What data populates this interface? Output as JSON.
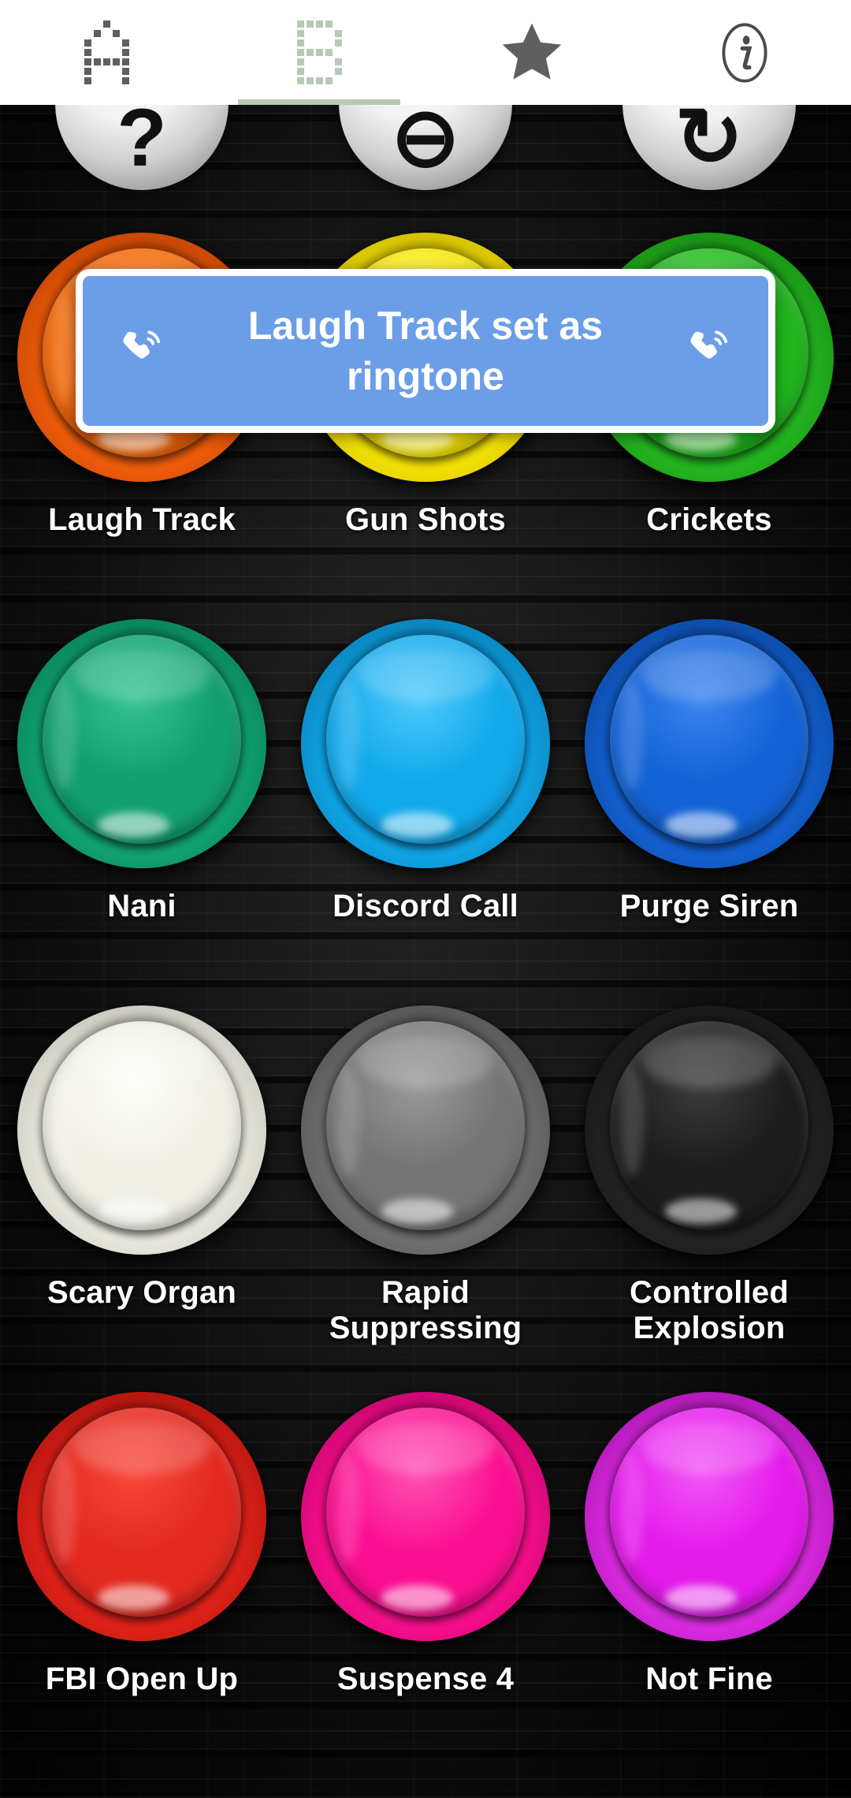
{
  "tabbar": {
    "tabs": [
      {
        "id": "tab-a",
        "icon": "pixel-letter-a-icon",
        "label": "A",
        "active": false,
        "color": "#5f5f5f"
      },
      {
        "id": "tab-b",
        "icon": "pixel-letter-b-icon",
        "label": "B",
        "active": true,
        "color": "#b6c9b6"
      },
      {
        "id": "tab-favorites",
        "icon": "star-icon",
        "label": "Favorites",
        "active": false,
        "color": "#5f5f5f"
      },
      {
        "id": "tab-info",
        "icon": "info-circle-icon",
        "label": "Info",
        "active": false,
        "color": "#5f5f5f"
      }
    ],
    "active_indicator_color": "#b6c9b6",
    "background": "#ffffff"
  },
  "toast": {
    "message": "Laugh Track set as ringtone",
    "background": "#6c9ee8",
    "border": "#ffffff",
    "text_color": "#ffffff",
    "left_icon": "ringing-phone-icon",
    "right_icon": "ringing-phone-icon"
  },
  "icon_row": [
    {
      "name": "icon-button-question",
      "symbol": "?"
    },
    {
      "name": "icon-button-minus",
      "symbol": "⊖"
    },
    {
      "name": "icon-button-repeat",
      "symbol": "↻"
    }
  ],
  "board": {
    "background": "#0b0b0b",
    "sounds": [
      {
        "name": "Laugh Track",
        "rim": "#ED5C0A",
        "rim_hi": "#F4721E",
        "rim_lo": "#B63F02",
        "cap": "#F2690C",
        "cap_hi": "#FF8A2E",
        "cap_lo": "#C44C03"
      },
      {
        "name": "Gun Shots",
        "rim": "#F2DF05",
        "rim_hi": "#FBEC2A",
        "rim_lo": "#C9B700",
        "cap": "#F7E800",
        "cap_hi": "#FFF75E",
        "cap_lo": "#D6C400"
      },
      {
        "name": "Crickets",
        "rim": "#24B521",
        "rim_hi": "#34CC2F",
        "rim_lo": "#158610",
        "cap": "#22B61F",
        "cap_hi": "#4BDB44",
        "cap_lo": "#139410"
      },
      {
        "name": "Nani",
        "rim": "#11A271",
        "rim_hi": "#1CBA86",
        "rim_lo": "#077A52",
        "cap": "#129F70",
        "cap_hi": "#33C492",
        "cap_lo": "#07805A"
      },
      {
        "name": "Discord Call",
        "rim": "#10A4E6",
        "rim_hi": "#2EBBF5",
        "rim_lo": "#0679AE",
        "cap": "#12A9EC",
        "cap_hi": "#4FCAFB",
        "cap_lo": "#0683BC"
      },
      {
        "name": "Purge Siren",
        "rim": "#1260CF",
        "rim_hi": "#2A78E6",
        "rim_lo": "#0B4399",
        "cap": "#1463D6",
        "cap_hi": "#3C86F0",
        "cap_lo": "#0A4AA6"
      },
      {
        "name": "Scary Organ",
        "rim": "#E7E7DE",
        "rim_hi": "#F6F6EF",
        "rim_lo": "#BFBFB4",
        "cap": "#EFEFE6",
        "cap_hi": "#FFFFFA",
        "cap_lo": "#CFCFC4"
      },
      {
        "name": "Rapid Suppressing",
        "rim": "#6F6F6F",
        "rim_hi": "#808080",
        "rim_lo": "#4E4E4E",
        "cap": "#757575",
        "cap_hi": "#9A9A9A",
        "cap_lo": "#565656"
      },
      {
        "name": "Controlled Explosion",
        "rim": "#232323",
        "rim_hi": "#2E2E2E",
        "rim_lo": "#141414",
        "cap": "#1D1D1D",
        "cap_hi": "#3C3C3C",
        "cap_lo": "#0D0D0D"
      },
      {
        "name": "FBI Open Up",
        "rim": "#E02219",
        "rim_hi": "#F03A2D",
        "rim_lo": "#A3110C",
        "cap": "#E32A20",
        "cap_hi": "#F9483A",
        "cap_lo": "#B0130D"
      },
      {
        "name": "Suspense 4",
        "rim": "#F70E8C",
        "rim_hi": "#FF35A2",
        "rim_lo": "#BC0468",
        "cap": "#FB0F92",
        "cap_hi": "#FF53B3",
        "cap_lo": "#C70572"
      },
      {
        "name": "Not Fine",
        "rim": "#DA2AE0",
        "rim_hi": "#E84EEE",
        "rim_lo": "#A112A8",
        "cap": "#E41BEB",
        "cap_hi": "#F257F7",
        "cap_lo": "#AE11B6"
      }
    ]
  }
}
